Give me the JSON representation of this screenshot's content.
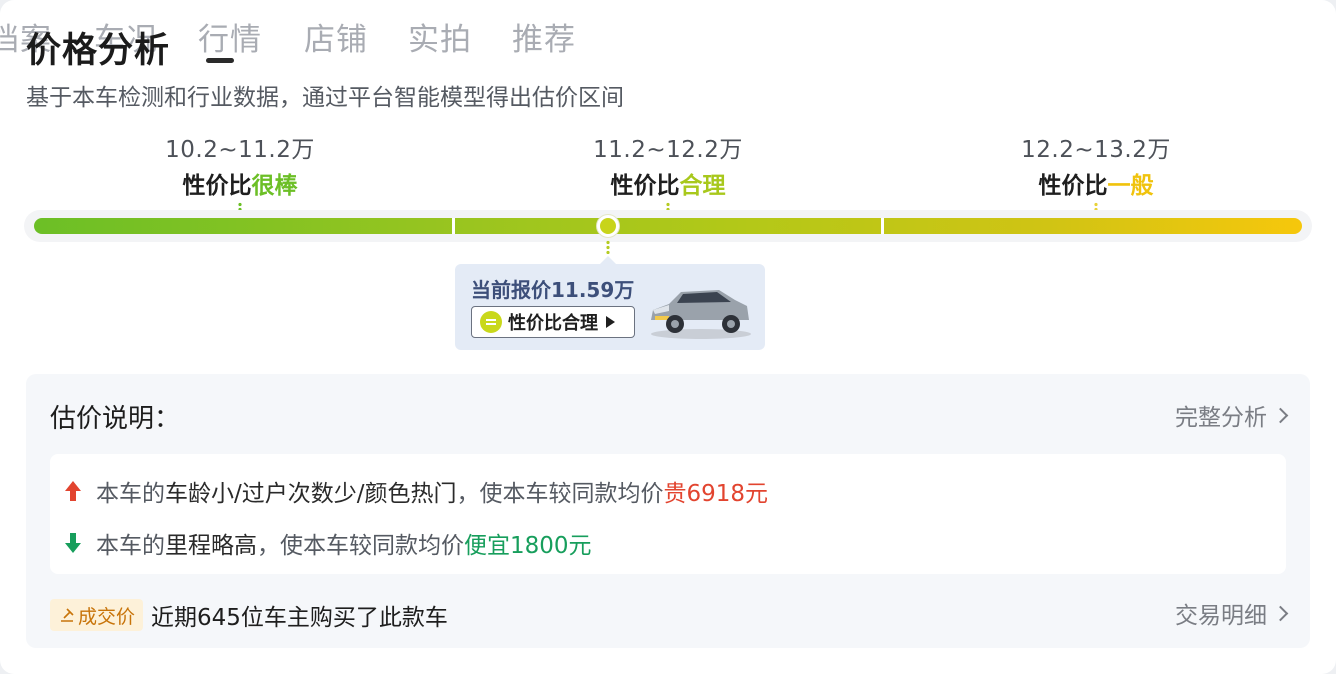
{
  "tabs": [
    "档案",
    "车况",
    "行情",
    "店铺",
    "实拍",
    "推荐"
  ],
  "title": "价格分析",
  "subtitle": "基于本车检测和行业数据，通过平台智能模型得出估价区间",
  "ranges": [
    {
      "price": "10.2~11.2万",
      "prefix": "性价比",
      "rating": "很棒",
      "color": "#6cbf26"
    },
    {
      "price": "11.2~12.2万",
      "prefix": "性价比",
      "rating": "合理",
      "color": "#a8c81c"
    },
    {
      "price": "12.2~13.2万",
      "prefix": "性价比",
      "rating": "一般",
      "color": "#f0c30d"
    }
  ],
  "current_price_fraction": 0.453,
  "tooltip": {
    "text": "当前报价11.59万",
    "badge": "性价比合理",
    "image": "gray-suv-car"
  },
  "explanation": {
    "title": "估价说明：",
    "link": "完整分析",
    "rows": [
      {
        "direction": "up",
        "lead": "本车的",
        "factors": "车龄小/过户次数少/颜色热门",
        "mid": "，使本车较同款均价",
        "diff": "贵6918元"
      },
      {
        "direction": "down",
        "lead": "本车的",
        "factors": "里程略高",
        "mid": "，使本车较同款均价",
        "diff": "便宜1800元"
      }
    ],
    "deal_badge": "成交价",
    "deal_text": "近期645位车主购买了此款车",
    "deal_link": "交易明细"
  },
  "colors": {
    "up": "#e2442f",
    "down": "#179e5c",
    "accent": "#c8d41a"
  }
}
